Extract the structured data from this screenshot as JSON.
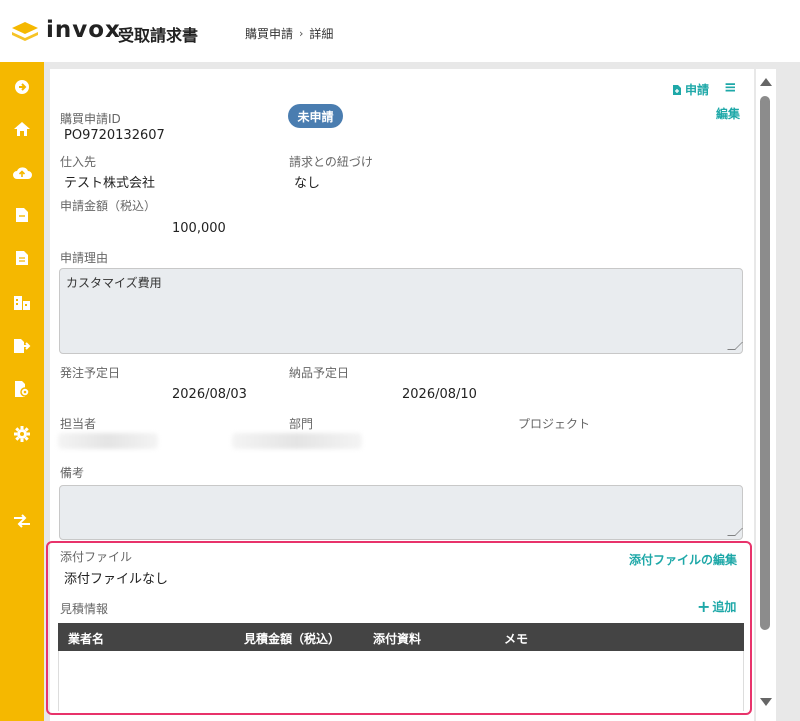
{
  "header": {
    "brand": "invox",
    "brand_sub": "受取請求書",
    "breadcrumb": [
      "購買申請",
      "詳細"
    ]
  },
  "colors": {
    "sidebar": "#f5b800",
    "accent": "#1ea8a8",
    "badge": "#4a7db0",
    "table_header": "#444444",
    "highlight": "#e8336b"
  },
  "sidebar": {
    "items": [
      {
        "icon": "arrow-right-circle-icon"
      },
      {
        "icon": "home-icon"
      },
      {
        "icon": "cloud-upload-icon"
      },
      {
        "icon": "document-icon"
      },
      {
        "icon": "document-lines-icon"
      },
      {
        "icon": "buildings-icon"
      },
      {
        "icon": "file-export-icon"
      },
      {
        "icon": "file-settings-icon"
      },
      {
        "icon": "gear-icon"
      },
      {
        "icon": "exchange-icon"
      }
    ]
  },
  "actions": {
    "apply": "申請",
    "menu": "≡",
    "edit": "編集"
  },
  "form": {
    "po_id_label": "購買申請ID",
    "po_id_value": "PO9720132607",
    "status_badge": "未申請",
    "vendor_label": "仕入先",
    "vendor_value": "テスト株式会社",
    "invoice_link_label": "請求との紐づけ",
    "invoice_link_value": "なし",
    "amount_label": "申請金額（税込）",
    "amount_value": "100,000",
    "reason_label": "申請理由",
    "reason_value": "カスタマイズ費用",
    "order_date_label": "発注予定日",
    "order_date_value": "2026/08/03",
    "delivery_date_label": "納品予定日",
    "delivery_date_value": "2026/08/10",
    "assignee_label": "担当者",
    "department_label": "部門",
    "project_label": "プロジェクト",
    "notes_label": "備考",
    "notes_value": ""
  },
  "attachments": {
    "label": "添付ファイル",
    "edit_link": "添付ファイルの編集",
    "empty": "添付ファイルなし"
  },
  "quotes": {
    "label": "見積情報",
    "add_link": "追加",
    "columns": [
      "業者名",
      "見積金額（税込）",
      "添付資料",
      "メモ"
    ]
  }
}
